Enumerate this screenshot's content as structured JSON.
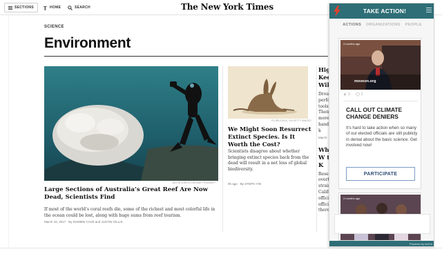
{
  "nyt": {
    "topbar": {
      "sections_label": "SECTIONS",
      "home_label": "HOME",
      "search_label": "SEARCH",
      "masthead": "The New York Times"
    },
    "section_kicker": "SCIENCE",
    "page_title": "Environment",
    "main_story": {
      "image_caption": "JUSTIN ZURICH, DELANEY RYAN/AFP",
      "headline": "Large Sections of Australia’s Great Reef Are Now Dead, Scientists Find",
      "summary": "If most of the world’s coral reefs die, some of the richest and most colorful life in the ocean could be lost, along with huge sums from reef tourism.",
      "byline": "March 15, 2017 · By DAMIEN CAVE and JUSTIN GILLIS"
    },
    "second_story": {
      "image_caption": "FLORILEGIUS, VIA GETTY IMAGES",
      "headline": "We Might Soon Resurrect Extinct Species. Is It Worth the Cost?",
      "summary": "Scientists disagree about whether bringing extinct species back from the dead will result in a net loss of global biodiversity.",
      "byline": "9h ago · By STEPH YIN"
    },
    "third_story": {
      "headline": "High Keep Wild",
      "summary": "Drous perfo tools. Them more hand had k",
      "byline": "March",
      "headline_2": "Wh A W to K",
      "summary_2": "Resea overf strain Califo offici offici there"
    }
  },
  "acton": {
    "title": "TAKE ACTION!",
    "tabs": [
      {
        "label": "ACTIONS",
        "active": true
      },
      {
        "label": "ORGANIZATIONS",
        "active": false
      },
      {
        "label": "PEOPLE",
        "active": false
      }
    ],
    "card": {
      "video_time": "3 months ago",
      "video_brand": "moveon.org",
      "stat_actions": "3",
      "stat_likes": "2",
      "title": "CALL OUT CLIMATE CHANGE DENIERS",
      "description": "It's hard to take action when so many of our elected officials are still publicly in denial about the basic science. Get involved now!",
      "button_label": "PARTICIPATE"
    },
    "card2": {
      "video_time": "3 months ago"
    },
    "footer": "Powered by ActOn",
    "colors": {
      "header_bg": "#2e6e76",
      "button_border": "#7a9bc4",
      "logo_red": "#e0412f"
    }
  }
}
